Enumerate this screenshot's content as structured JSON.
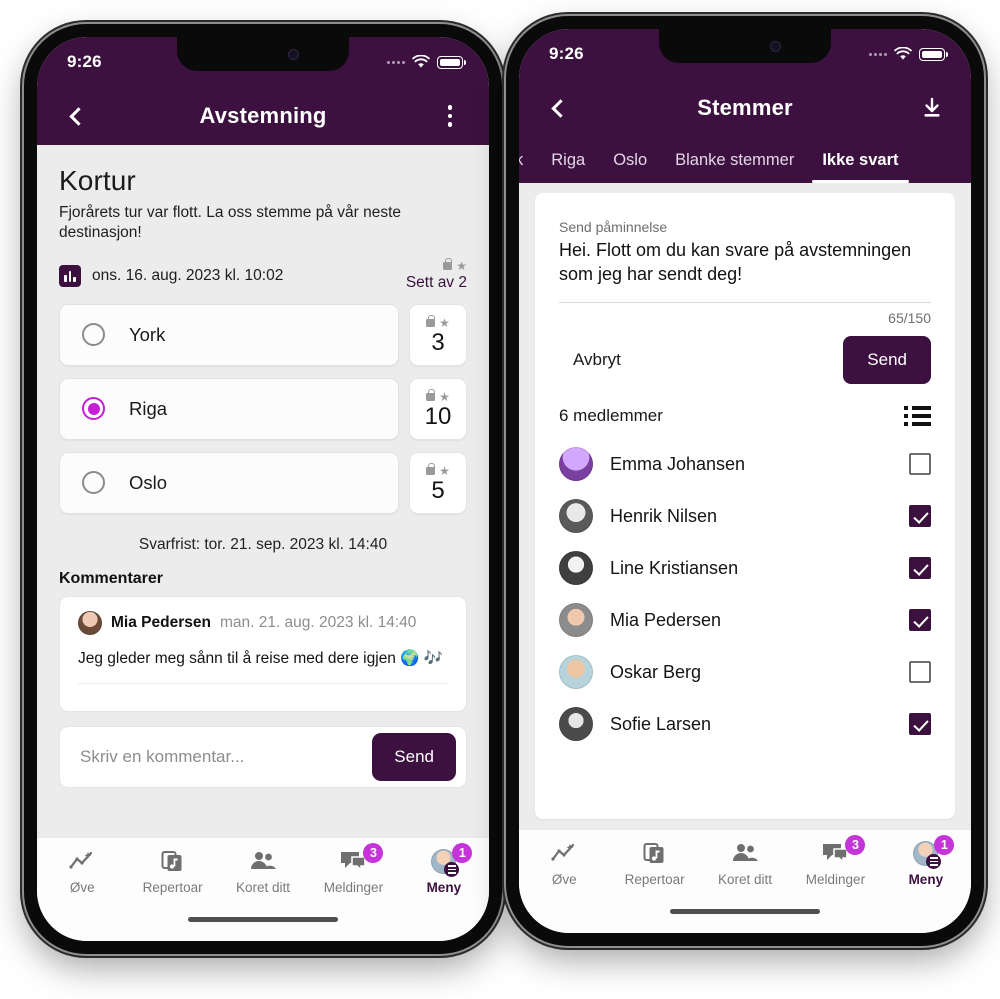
{
  "status_bar": {
    "time": "9:26"
  },
  "colors": {
    "brand_purple": "#3C1140",
    "accent_magenta": "#C41FD4",
    "badge_magenta": "#C434D8",
    "screen_bg": "#ECECEC"
  },
  "phone1": {
    "appbar": {
      "title": "Avstemning",
      "back_icon": "chevron-left-icon",
      "menu_icon": "kebab-menu-icon"
    },
    "poll": {
      "title": "Kortur",
      "description": "Fjorårets tur var flott. La oss stemme på vår neste destinasjon!",
      "date": "ons. 16. aug. 2023 kl. 10:02",
      "seen_label": "Sett av 2",
      "deadline": "Svarfrist: tor. 21. sep. 2023 kl. 14:40",
      "options": [
        {
          "label": "York",
          "count": "3",
          "selected": false
        },
        {
          "label": "Riga",
          "count": "10",
          "selected": true
        },
        {
          "label": "Oslo",
          "count": "5",
          "selected": false
        }
      ]
    },
    "comments": {
      "heading": "Kommentarer",
      "items": [
        {
          "author": "Mia Pedersen",
          "date": "man. 21. aug. 2023 kl. 14:40",
          "text": "Jeg gleder meg sånn til å reise med dere igjen 🌍 🎶"
        }
      ],
      "composer": {
        "placeholder": "Skriv en kommentar...",
        "value": "",
        "send_label": "Send"
      }
    }
  },
  "phone2": {
    "appbar": {
      "title": "Stemmer",
      "back_icon": "chevron-left-icon",
      "download_icon": "download-icon"
    },
    "tabs": [
      {
        "label": "k",
        "active": false,
        "clipped": true
      },
      {
        "label": "Riga",
        "active": false
      },
      {
        "label": "Oslo",
        "active": false
      },
      {
        "label": "Blanke stemmer",
        "active": false
      },
      {
        "label": "Ikke svart",
        "active": true
      }
    ],
    "reminder": {
      "label": "Send påminnelse",
      "message": "Hei. Flott om du kan svare på avstemningen som jeg har sendt deg!",
      "counter": "65/150",
      "cancel_label": "Avbryt",
      "send_label": "Send"
    },
    "members": {
      "count_label": "6 medlemmer",
      "list_icon": "list-view-icon",
      "items": [
        {
          "name": "Emma Johansen",
          "checked": false
        },
        {
          "name": "Henrik Nilsen",
          "checked": true
        },
        {
          "name": "Line Kristiansen",
          "checked": true
        },
        {
          "name": "Mia Pedersen",
          "checked": true
        },
        {
          "name": "Oskar Berg",
          "checked": false
        },
        {
          "name": "Sofie Larsen",
          "checked": true
        }
      ]
    }
  },
  "bottom_nav": {
    "items": [
      {
        "label": "Øve",
        "icon": "practice-chart-icon",
        "badge": "",
        "active": false
      },
      {
        "label": "Repertoar",
        "icon": "music-library-icon",
        "badge": "",
        "active": false
      },
      {
        "label": "Koret ditt",
        "icon": "people-group-icon",
        "badge": "",
        "active": false
      },
      {
        "label": "Meldinger",
        "icon": "chat-bubbles-icon",
        "badge": "3",
        "active": false
      },
      {
        "label": "Meny",
        "icon": "profile-avatar-icon",
        "badge": "1",
        "active": true
      }
    ]
  }
}
